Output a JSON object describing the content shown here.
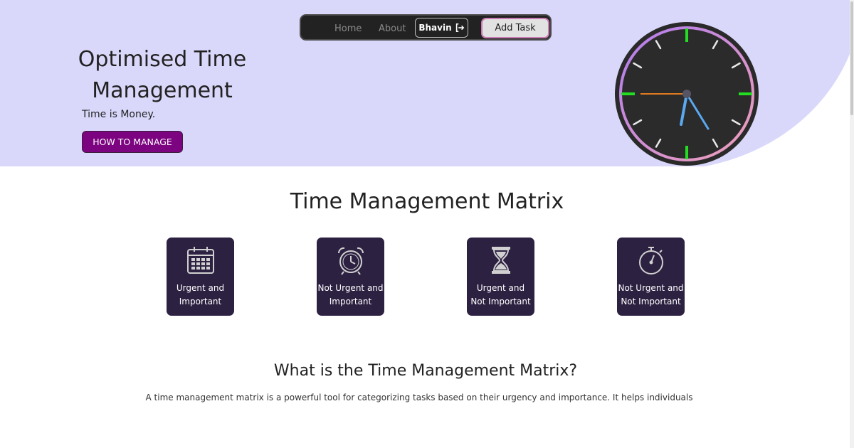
{
  "nav": {
    "home": "Home",
    "about": "About",
    "user": "Bhavin",
    "add_task": "Add Task"
  },
  "hero": {
    "title": "Optimised Time Management",
    "subtitle": "Time is Money.",
    "cta": "HOW TO MANAGE"
  },
  "matrix": {
    "title": "Time Management Matrix",
    "cards": [
      {
        "label": "Urgent and\nImportant",
        "icon": "calendar-icon"
      },
      {
        "label": "Not Urgent and\nImportant",
        "icon": "alarm-clock-icon"
      },
      {
        "label": "Urgent and\nNot Important",
        "icon": "hourglass-icon"
      },
      {
        "label": "Not Urgent and\nNot Important",
        "icon": "stopwatch-icon"
      }
    ]
  },
  "about": {
    "title": "What is the Time Management Matrix?",
    "text": "A time management matrix is a powerful tool for categorizing tasks based on their urgency and importance. It helps individuals"
  },
  "colors": {
    "hero_bg": "#d9d8fb",
    "nav_bg": "#222222",
    "cta_bg": "#7c0480",
    "card_bg": "#2d2142"
  }
}
